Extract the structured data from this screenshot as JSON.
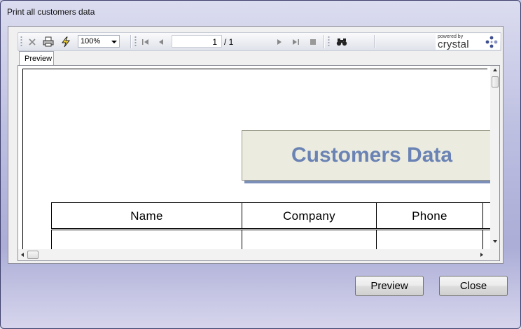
{
  "window": {
    "title": "Print all customers data"
  },
  "toolbar": {
    "zoom_value": "100%",
    "page_current": "1",
    "page_total": "/ 1",
    "icons": [
      "close-icon",
      "print-icon",
      "refresh-icon",
      "first-page-icon",
      "prev-page-icon",
      "next-page-icon",
      "last-page-icon",
      "stop-icon",
      "find-icon"
    ]
  },
  "branding": {
    "powered_by": "powered by",
    "product": "crystal"
  },
  "tabs": [
    {
      "label": "Preview"
    }
  ],
  "report": {
    "title": "Customers Data",
    "columns": [
      "Name",
      "Company",
      "Phone"
    ]
  },
  "buttons": {
    "preview_label": "Preview",
    "close_label": "Close"
  },
  "colors": {
    "report_title": "#6a83b4",
    "title_box_bg": "#ebebdf",
    "title_box_shadow": "#7b8fb9"
  }
}
